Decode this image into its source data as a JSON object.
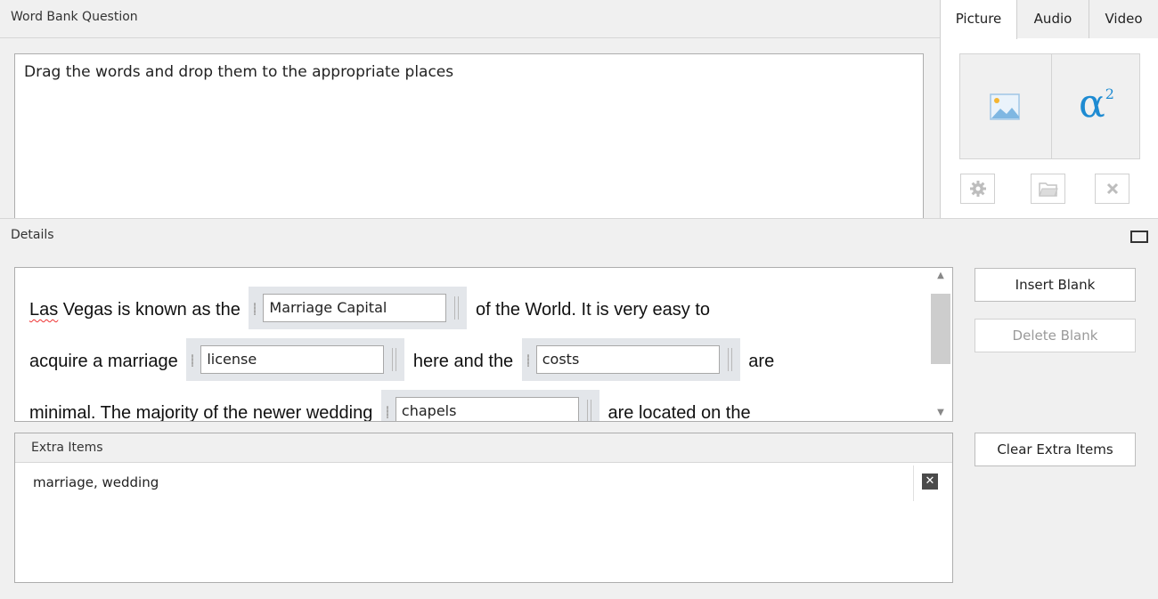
{
  "question": {
    "header": "Word Bank Question",
    "text": "Drag the words and drop them to the appropriate places"
  },
  "media": {
    "tabs": [
      "Picture",
      "Audio",
      "Video"
    ],
    "active_tab": "Picture",
    "icons": {
      "insert_image": "image-icon",
      "insert_formula": "formula-icon",
      "settings": "gear-icon",
      "open": "folder-icon",
      "delete": "close-icon"
    }
  },
  "details": {
    "header": "Details",
    "lines": [
      {
        "before": "Las",
        "a": " Vegas is known as the ",
        "blank": "Marriage Capital",
        "after": " of the World. It is very easy to"
      },
      {
        "a": "acquire a marriage ",
        "blank1": "license",
        "b": " here and the ",
        "blank2": "costs",
        "c": " are"
      },
      {
        "a": "minimal. The majority of the newer wedding ",
        "blank": "chapels",
        "b": " are located on the"
      }
    ],
    "buttons": {
      "insert_blank": "Insert Blank",
      "delete_blank": "Delete Blank",
      "clear_extra": "Clear Extra Items"
    }
  },
  "extra_items": {
    "header": "Extra Items",
    "value": "marriage, wedding",
    "remove_glyph": "✕"
  },
  "colors": {
    "accent": "#1e8bd2",
    "panel_bg": "#f0f0f0",
    "blank_bg": "#e3e6ea"
  }
}
